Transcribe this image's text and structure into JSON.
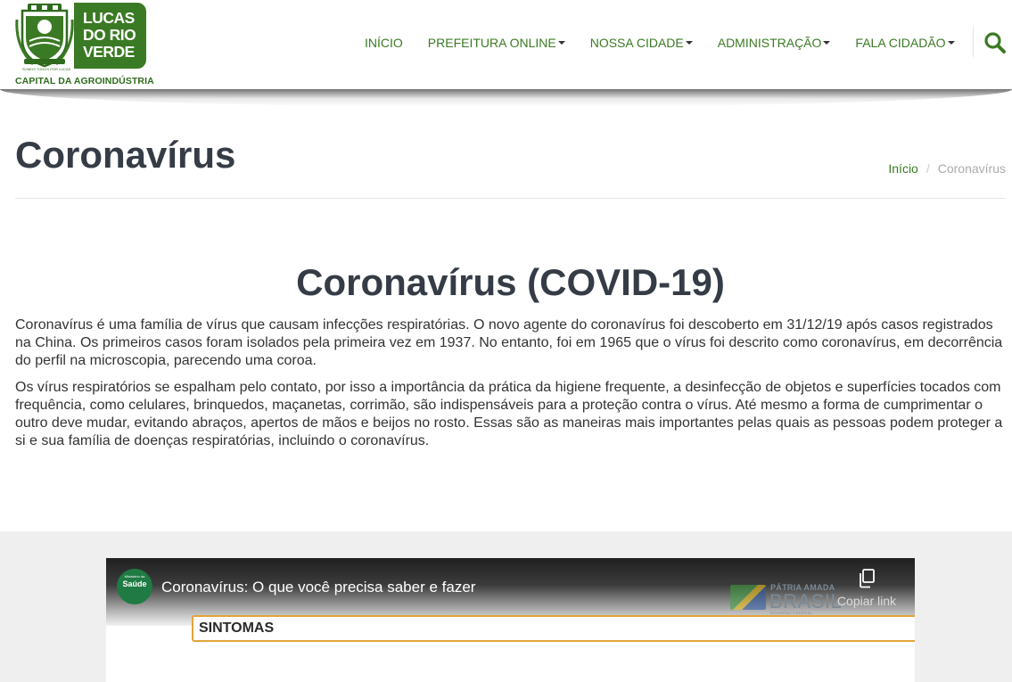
{
  "header": {
    "logo": {
      "line1": "LUCAS",
      "line2": "DO RIO",
      "line3": "VERDE",
      "motto": "SOMOS TODOS POR LUCAS",
      "tagline": "CAPITAL DA AGROINDÚSTRIA"
    },
    "nav": [
      {
        "label": "INÍCIO",
        "dropdown": false
      },
      {
        "label": "PREFEITURA ONLINE",
        "dropdown": true
      },
      {
        "label": "NOSSA CIDADE",
        "dropdown": true
      },
      {
        "label": "ADMINISTRAÇÃO",
        "dropdown": true
      },
      {
        "label": "FALA CIDADÃO",
        "dropdown": true
      }
    ],
    "search_icon": "search-icon"
  },
  "page": {
    "title": "Coronavírus",
    "breadcrumb": {
      "home": "Início",
      "separator": "/",
      "current": "Coronavírus"
    }
  },
  "article": {
    "heading": "Coronavírus (COVID-19)",
    "paragraphs": [
      "Coronavírus é uma família de vírus que causam infecções respiratórias. O novo agente do coronavírus foi descoberto em 31/12/19 após casos registrados na China. Os primeiros casos foram isolados pela primeira vez em 1937. No entanto, foi em 1965 que o vírus foi descrito como coronavírus, em decorrência do perfil na microscopia, parecendo uma coroa.",
      "Os vírus respiratórios se espalham pelo contato, por isso a importância da prática da higiene frequente, a desinfecção de objetos e superfícies tocados com frequência, como celulares, brinquedos, maçanetas, corrimão, são indispensáveis para a proteção contra o vírus. Até mesmo a forma de cumprimentar o outro deve mudar, evitando abraços, apertos de mãos e beijos no rosto. Essas são as maneiras mais importantes pelas quais as pessoas podem proteger a si e sua família de doenças respiratórias, incluindo o coronavírus."
    ]
  },
  "video": {
    "channel_avatar_top": "Ministério da",
    "channel_avatar_text": "Saúde",
    "title": "Coronavírus: O que você precisa saber e fazer",
    "gov_logo": {
      "line1": "PÁTRIA AMADA",
      "line2": "BRASIL",
      "line3": "GOVERNO FEDERAL"
    },
    "copy_link_label": "Copiar link",
    "frame_text": "SINTOMAS"
  },
  "colors": {
    "brand_green": "#3b7a24",
    "heading": "#353c46",
    "body_text": "#333333",
    "section_gray": "#efefef",
    "accent_orange": "#e3a43a"
  }
}
